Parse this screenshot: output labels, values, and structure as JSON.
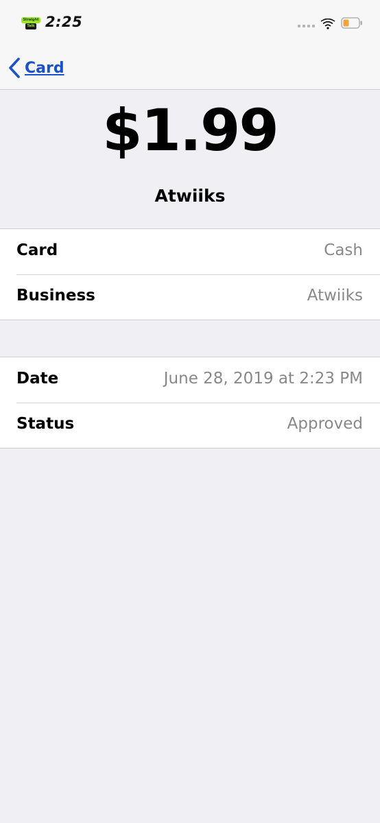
{
  "status_bar": {
    "carrier_logo_top": "Straight",
    "carrier_logo_bottom": "Talk",
    "time": "2:25",
    "icons": [
      "signal-dots-icon",
      "wifi-icon",
      "battery-low-icon"
    ],
    "battery_color": "#f2a33a"
  },
  "nav": {
    "back_label": "Card",
    "accent_color": "#1b52c8"
  },
  "transaction": {
    "amount": "$1.99",
    "merchant": "Atwiiks"
  },
  "details_group_1": [
    {
      "label": "Card",
      "value": "Cash"
    },
    {
      "label": "Business",
      "value": "Atwiiks"
    }
  ],
  "details_group_2": [
    {
      "label": "Date",
      "value": "June 28, 2019 at 2:23 PM"
    },
    {
      "label": "Status",
      "value": "Approved"
    }
  ]
}
